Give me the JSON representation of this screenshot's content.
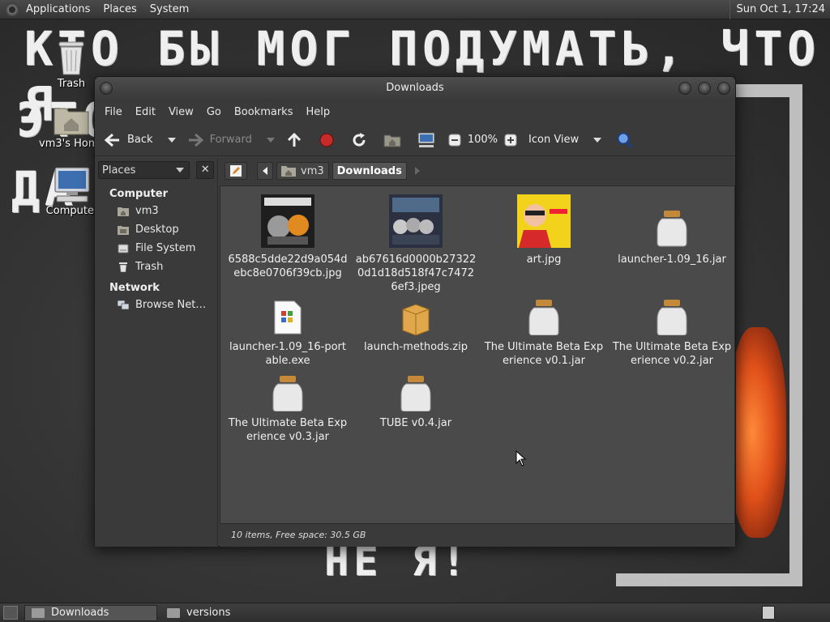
{
  "top_panel": {
    "menus": [
      "Applications",
      "Places",
      "System"
    ],
    "clock": "Sun Oct  1, 17:24"
  },
  "wallpaper": {
    "line1": "КТО БЫ МОГ ПОДУМАТЬ, ЧТО Я -",
    "line2": "ЭТО",
    "line3": "ДА",
    "bottom": "НЕ Я!"
  },
  "desktop_icons": {
    "trash": "Trash",
    "home": "vm3's Home",
    "computer": "Computer"
  },
  "window": {
    "title": "Downloads",
    "menus": [
      "File",
      "Edit",
      "View",
      "Go",
      "Bookmarks",
      "Help"
    ],
    "toolbar": {
      "back": "Back",
      "forward": "Forward",
      "zoom": "100%",
      "view_mode": "Icon View"
    },
    "sidebar": {
      "selector": "Places",
      "close": "✕",
      "computer_head": "Computer",
      "computer_items": [
        "vm3",
        "Desktop",
        "File System",
        "Trash"
      ],
      "network_head": "Network",
      "network_items": [
        "Browse Net…"
      ]
    },
    "pathbar": {
      "crumbs": [
        "vm3",
        "Downloads"
      ]
    },
    "files": [
      {
        "name": "6588c5dde22d9a054debc8e0706f39cb.jpg",
        "kind": "comic"
      },
      {
        "name": "ab67616d0000b273220d1d18d518f47c74726ef3.jpeg",
        "kind": "band"
      },
      {
        "name": "art.jpg",
        "kind": "art"
      },
      {
        "name": "launcher-1.09_16.jar",
        "kind": "jar"
      },
      {
        "name": "launcher-1.09_16-portable.exe",
        "kind": "exe"
      },
      {
        "name": "launch-methods.zip",
        "kind": "zip"
      },
      {
        "name": "The Ultimate Beta Experience v0.1.jar",
        "kind": "jar"
      },
      {
        "name": "The Ultimate Beta Experience v0.2.jar",
        "kind": "jar"
      },
      {
        "name": "The Ultimate Beta Experience v0.3.jar",
        "kind": "jar"
      },
      {
        "name": "TUBE v0.4.jar",
        "kind": "jar"
      }
    ],
    "status": "10 items, Free space: 30.5 GB"
  },
  "taskbar": {
    "tasks": [
      "Downloads",
      "versions"
    ]
  }
}
